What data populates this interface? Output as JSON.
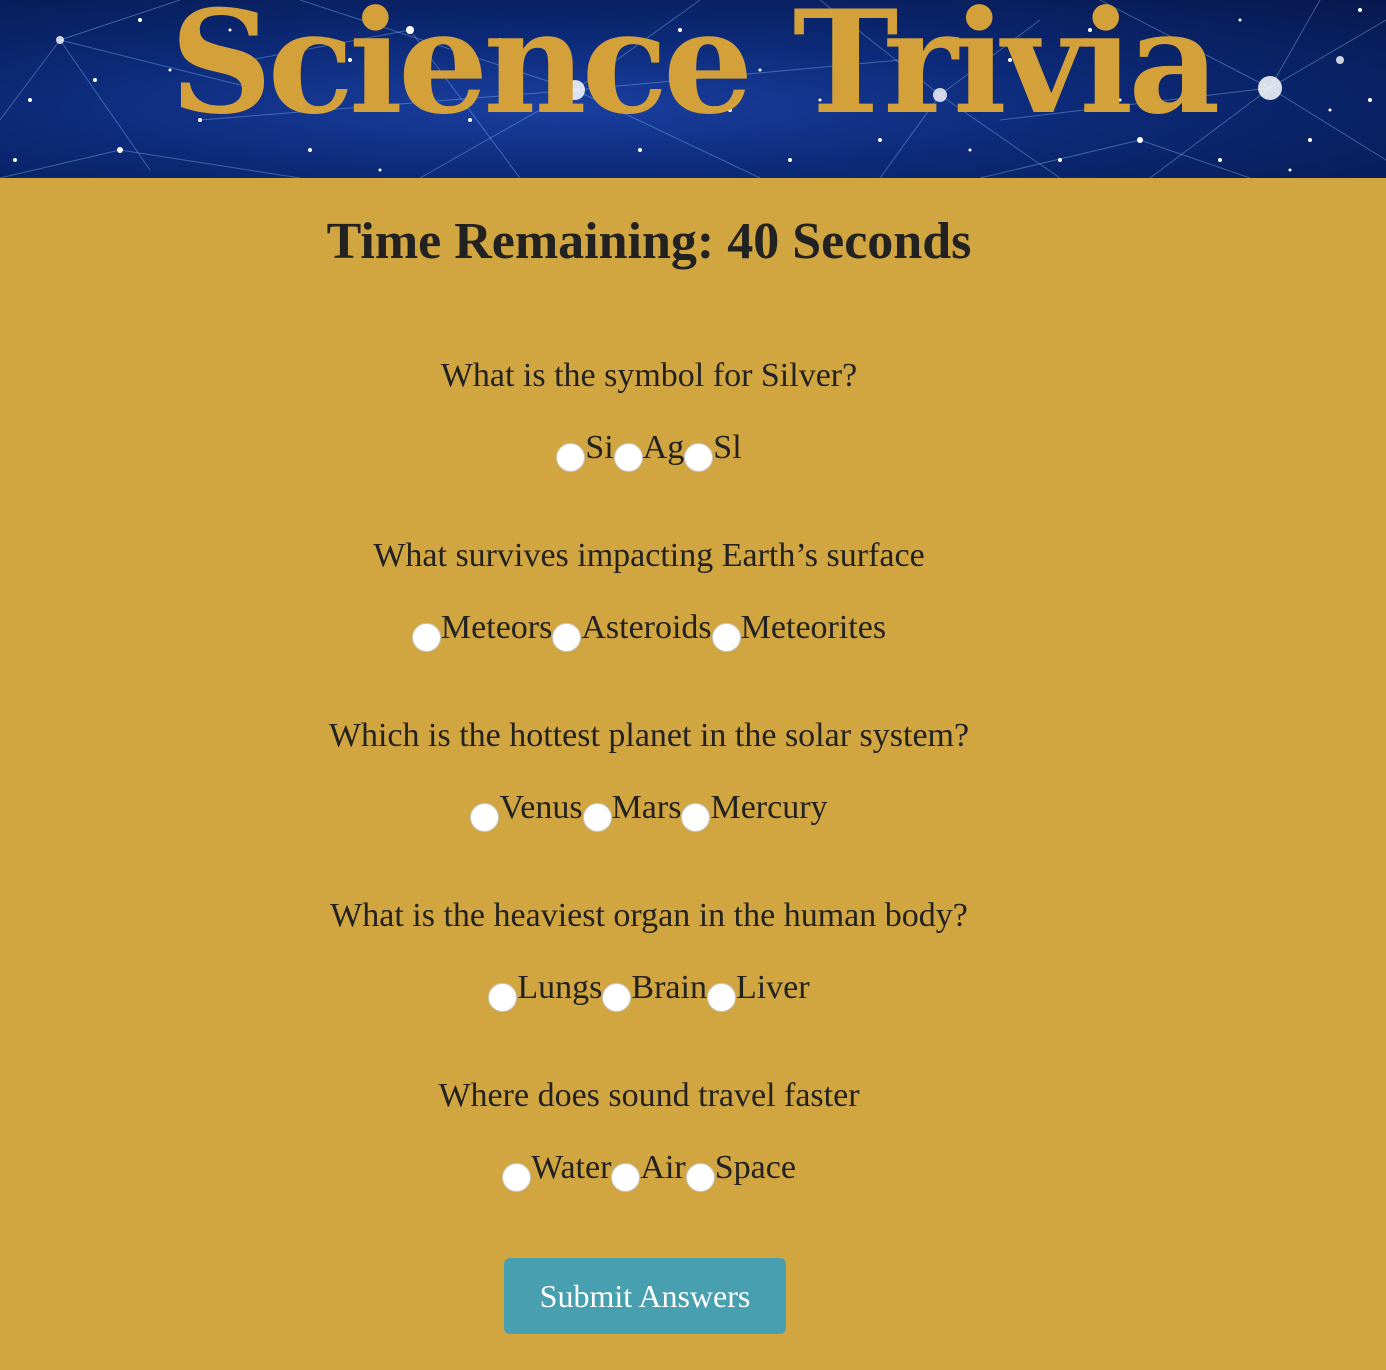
{
  "header": {
    "title": "Science Trivia",
    "title_color": "#d3a03a"
  },
  "timer": {
    "text": "Time Remaining: 40 Seconds"
  },
  "questions": [
    {
      "text": "What is the symbol for Silver?",
      "options": [
        "Si",
        "Ag",
        "Sl"
      ]
    },
    {
      "text": "What survives impacting Earth’s surface",
      "options": [
        "Meteors",
        "Asteroids",
        "Meteorites"
      ]
    },
    {
      "text": "Which is the hottest planet in the solar system?",
      "options": [
        "Venus",
        "Mars",
        "Mercury"
      ]
    },
    {
      "text": "What is the heaviest organ in the human body?",
      "options": [
        "Lungs",
        "Brain",
        "Liver"
      ]
    },
    {
      "text": "Where does sound travel faster",
      "options": [
        "Water",
        "Air",
        "Space"
      ]
    }
  ],
  "submit": {
    "label": "Submit Answers"
  },
  "colors": {
    "background": "#d1a53f",
    "button": "#479faf",
    "banner": "#0c2a78"
  }
}
